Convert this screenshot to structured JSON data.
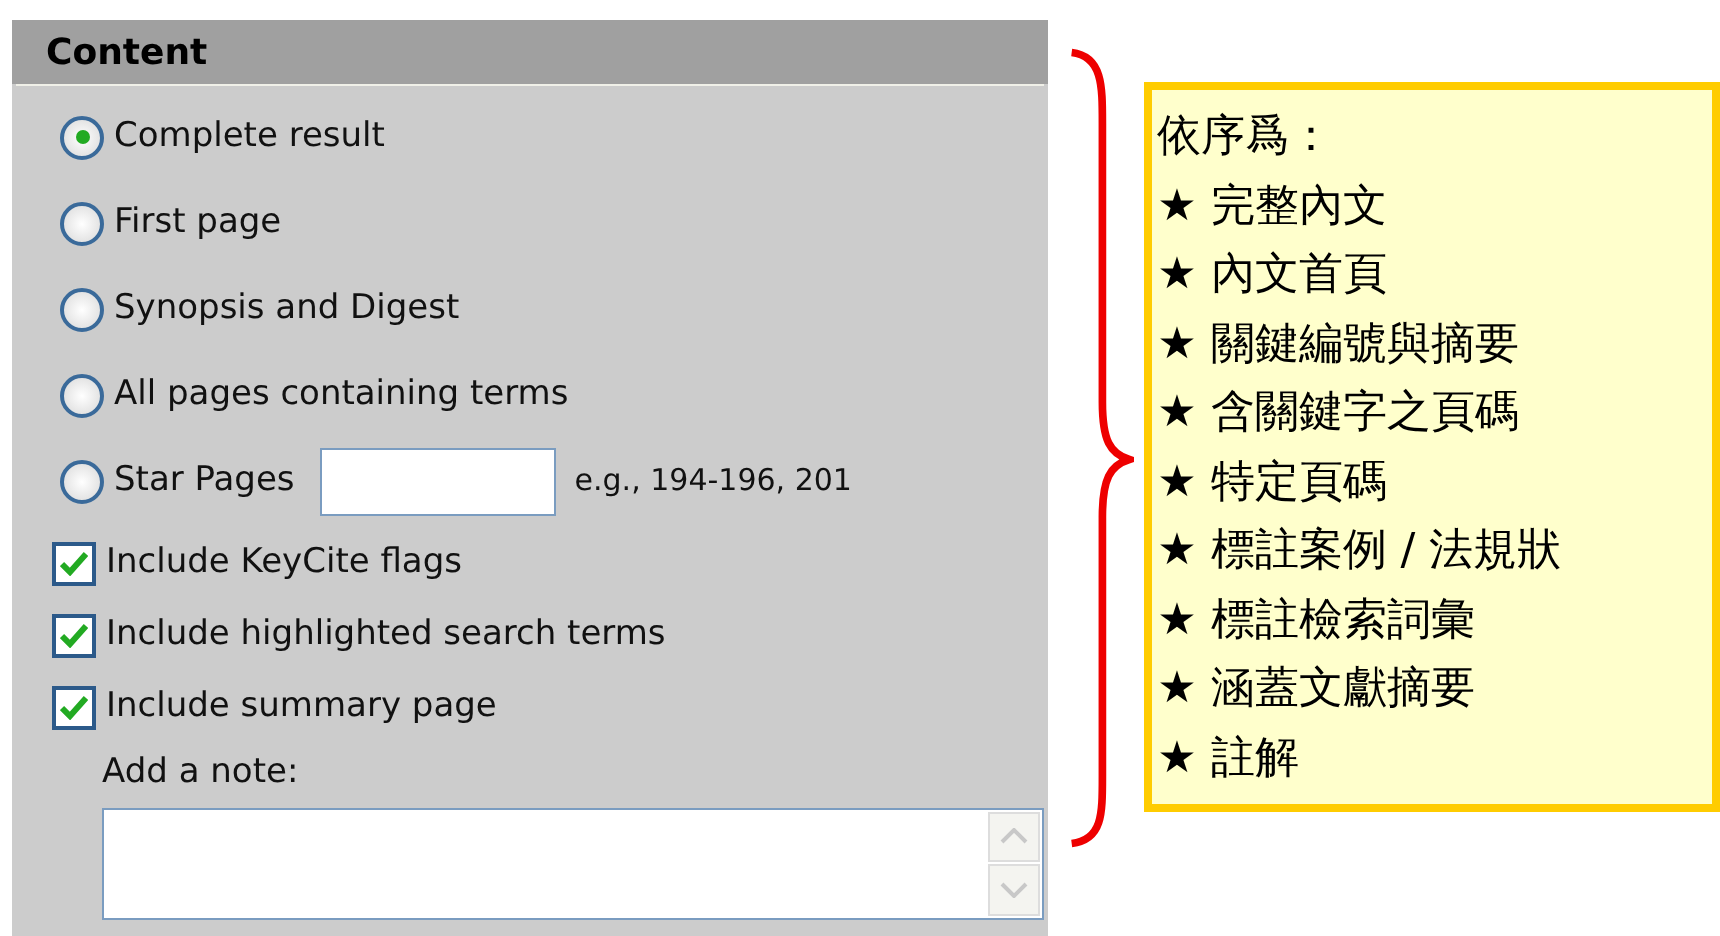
{
  "panel": {
    "title": "Content",
    "options": [
      {
        "label": "Complete result",
        "selected": true
      },
      {
        "label": "First page",
        "selected": false
      },
      {
        "label": "Synopsis and Digest",
        "selected": false
      },
      {
        "label": "All pages containing terms",
        "selected": false
      },
      {
        "label": "Star Pages",
        "selected": false,
        "kind": "pages",
        "hint": "e.g., 194-196, 201"
      }
    ],
    "checkboxes": [
      {
        "label": "Include KeyCite flags",
        "checked": true
      },
      {
        "label": "Include highlighted search terms",
        "checked": true
      },
      {
        "label": "Include summary page",
        "checked": true
      }
    ],
    "note_label": "Add a note:"
  },
  "callout": {
    "title": "依序爲：",
    "items": [
      "★ 完整內文",
      "★ 內文首頁",
      "★ 關鍵編號與摘要",
      "★ 含關鍵字之頁碼",
      "★ 特定頁碼",
      "★ 標註案例 / 法規狀",
      "★ 標註檢索詞彙",
      "★ 涵蓋文獻摘要",
      "★ 註解"
    ]
  }
}
